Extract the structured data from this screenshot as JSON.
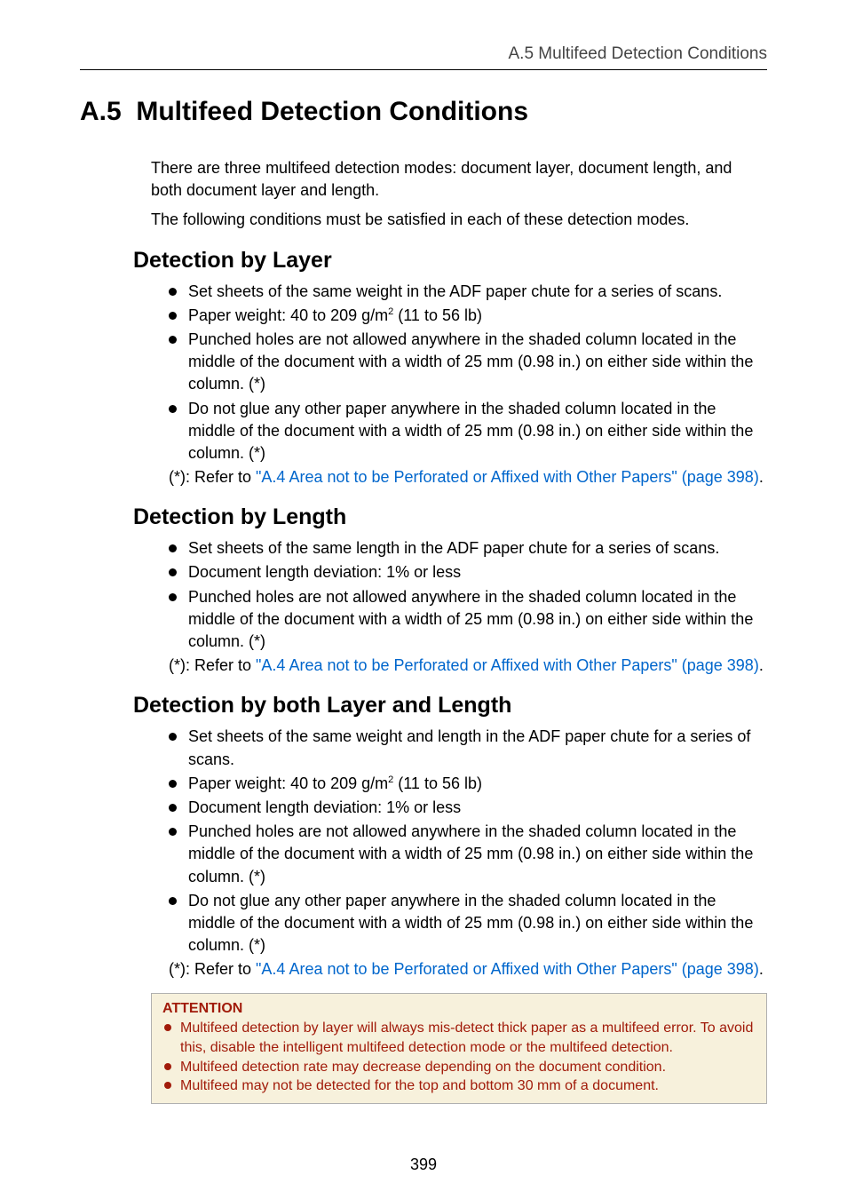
{
  "header": {
    "right_text": "A.5 Multifeed Detection Conditions"
  },
  "title": {
    "number": "A.5",
    "text": "Multifeed Detection Conditions"
  },
  "intro": {
    "p1": "There are three multifeed detection modes: document layer, document length, and both document layer and length.",
    "p2": "The following conditions must be satisfied in each of these detection modes."
  },
  "sections": {
    "layer": {
      "heading": "Detection by Layer",
      "items": [
        "Set sheets of the same weight in the ADF paper chute for a series of scans.",
        "Paper weight: 40 to 209 g/m² (11 to 56 lb)",
        "Punched holes are not allowed anywhere in the shaded column located in the middle of the document with a width of 25 mm (0.98 in.) on either side within the column. (*)",
        "Do not glue any other paper anywhere in the shaded column located in the middle of the document with a width of 25 mm (0.98 in.) on either side within the column. (*)"
      ],
      "footnote_prefix": "(*): Refer to ",
      "footnote_link": "\"A.4 Area not to be Perforated or Affixed with Other Papers\" (page 398)",
      "footnote_suffix": "."
    },
    "length": {
      "heading": "Detection by Length",
      "items": [
        "Set sheets of the same length in the ADF paper chute for a series of scans.",
        "Document length deviation: 1% or less",
        "Punched holes are not allowed anywhere in the shaded column located in the middle of the document with a width of 25 mm (0.98 in.) on either side within the column. (*)"
      ],
      "footnote_prefix": "(*): Refer to ",
      "footnote_link": "\"A.4 Area not to be Perforated or Affixed with Other Papers\" (page 398)",
      "footnote_suffix": "."
    },
    "both": {
      "heading": "Detection by both Layer and Length",
      "items": [
        "Set sheets of the same weight and length in the ADF paper chute for a series of scans.",
        "Paper weight: 40 to 209 g/m² (11 to 56 lb)",
        "Document length deviation: 1% or less",
        "Punched holes are not allowed anywhere in the shaded column located in the middle of the document with a width of 25 mm (0.98 in.) on either side within the column. (*)",
        "Do not glue any other paper anywhere in the shaded column located in the middle of the document with a width of 25 mm (0.98 in.) on either side within the column. (*)"
      ],
      "footnote_prefix": "(*): Refer to ",
      "footnote_link": "\"A.4 Area not to be Perforated or Affixed with Other Papers\" (page 398)",
      "footnote_suffix": "."
    }
  },
  "attention": {
    "title": "ATTENTION",
    "items": [
      "Multifeed detection by layer will always mis-detect thick paper as a multifeed error. To avoid this, disable the intelligent multifeed detection mode or the multifeed detection.",
      "Multifeed detection rate may decrease depending on the document condition.",
      "Multifeed may not be detected for the top and bottom 30 mm of a document."
    ]
  },
  "page_number": "399"
}
